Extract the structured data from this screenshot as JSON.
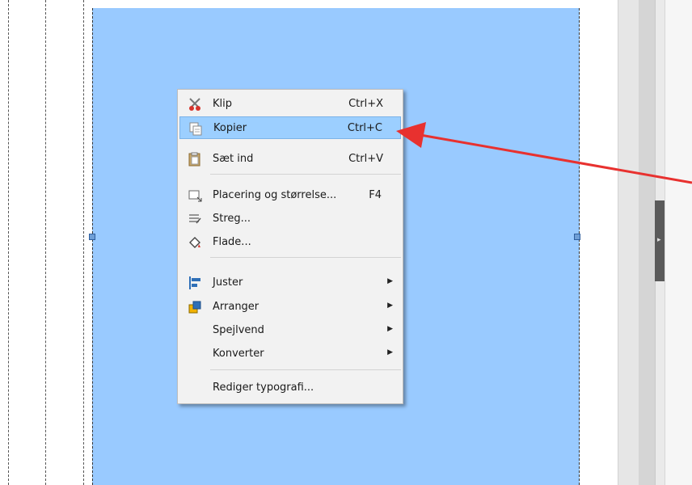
{
  "colors": {
    "shape_fill": "#99caff",
    "menu_bg": "#f2f2f2",
    "highlight": "#9ccfff",
    "annotation_arrow": "#e8312f"
  },
  "context_menu": {
    "items": [
      {
        "label": "Klip",
        "shortcut": "Ctrl+X",
        "icon": "scissors-icon"
      },
      {
        "label": "Kopier",
        "shortcut": "Ctrl+C",
        "icon": "copy-icon",
        "highlighted": true
      },
      {
        "label": "Sæt ind",
        "shortcut": "Ctrl+V",
        "icon": "paste-icon"
      },
      {
        "label": "Placering og størrelse...",
        "shortcut": "F4",
        "icon": "position-size-icon"
      },
      {
        "label": "Streg...",
        "shortcut": "",
        "icon": "line-icon"
      },
      {
        "label": "Flade...",
        "shortcut": "",
        "icon": "area-fill-icon"
      },
      {
        "label": "Juster",
        "shortcut": "",
        "icon": "align-icon",
        "submenu": true
      },
      {
        "label": "Arranger",
        "shortcut": "",
        "icon": "arrange-icon",
        "submenu": true
      },
      {
        "label": "Spejlvend",
        "shortcut": "",
        "icon": "",
        "submenu": true
      },
      {
        "label": "Konverter",
        "shortcut": "",
        "icon": "",
        "submenu": true
      },
      {
        "label": "Rediger typografi...",
        "shortcut": "",
        "icon": ""
      }
    ]
  }
}
